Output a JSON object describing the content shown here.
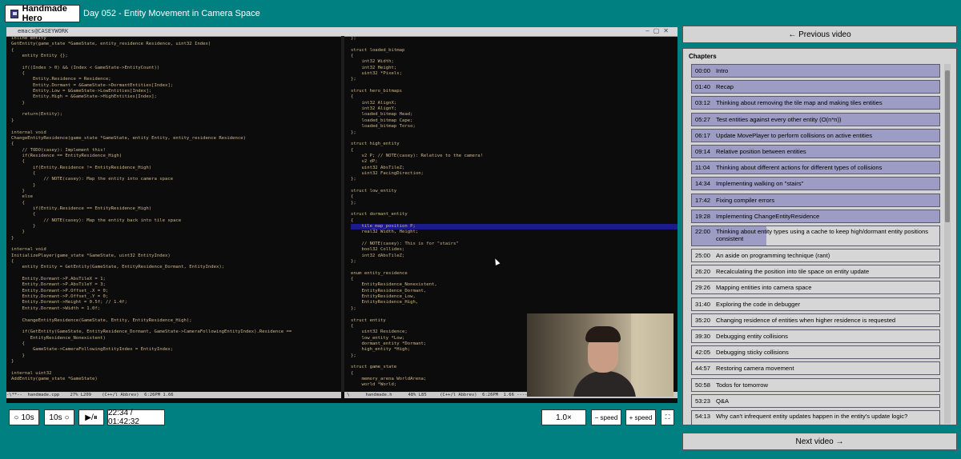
{
  "header": {
    "logo_label": "Handmade Hero",
    "episode_title": "Day 052 - Entity Movement in Camera Space"
  },
  "emacs": {
    "title": "emacs@CASEYWORK",
    "left_modeline": "-\\**--  handmade.cpp    27% L209    (C++/l Abbrev)  6:26PM 1.66",
    "right_modeline": " \\      handmade.h      48% L85     (C++/l Abbrev)  6:26PM  1.66 --------------------"
  },
  "code_left": [
    "inline entity",
    "GetEntity(game_state *GameState, entity_residence Residence, uint32 Index)",
    "{",
    "    entity Entity {};",
    "",
    "    if((Index > 0) && (Index < GameState->EntityCount))",
    "    {",
    "        Entity.Residence = Residence;",
    "        Entity.Dormant = &GameState->DormantEntities[Index];",
    "        Entity.Low = &GameState->LowEntities[Index];",
    "        Entity.High = &GameState->HighEntities[Index];",
    "    }",
    "",
    "    return(Entity);",
    "}",
    "",
    "internal void",
    "ChangeEntityResidence(game_state *GameState, entity Entity, entity_residence Residence)",
    "{",
    "    // TODO(casey): Implement this!",
    "    if(Residence == EntityResidence_High)",
    "    {",
    "        if(Entity.Residence != EntityResidence_High)",
    "        {",
    "            // NOTE(casey): Map the entity into camera space",
    "        }",
    "    }",
    "    else",
    "    {",
    "        if(Entity.Residence == EntityResidence_High)",
    "        {",
    "            // NOTE(casey): Map the entity back into tile space",
    "        }",
    "    }",
    "}",
    "",
    "internal void",
    "InitializePlayer(game_state *GameState, uint32 EntityIndex)",
    "{",
    "    entity Entity = GetEntity(GameState, EntityResidence_Dormant, EntityIndex);",
    "",
    "    Entity.Dormant->P.AbsTileX = 1;",
    "    Entity.Dormant->P.AbsTileY = 3;",
    "    Entity.Dormant->P.Offset_.X = 0;",
    "    Entity.Dormant->P.Offset_.Y = 0;",
    "    Entity.Dormant->Height = 0.5f; // 1.4f;",
    "    Entity.Dormant->Width = 1.0f;",
    "",
    "    ChangeEntityResidence(GameState, Entity, EntityResidence_High);",
    "",
    "    if(GetEntity(GameState, EntityResidence_Dormant, GameState->CameraFollowingEntityIndex).Residence ==",
    "       EntityResidence_Nonexistent)",
    "    {",
    "        GameState->CameraFollowingEntityIndex = EntityIndex;",
    "    }",
    "}",
    "",
    "internal uint32",
    "AddEntity(game_state *GameState)"
  ],
  "code_right": [
    "};",
    "",
    "struct loaded_bitmap",
    "{",
    "    int32 Width;",
    "    int32 Height;",
    "    uint32 *Pixels;",
    "};",
    "",
    "struct hero_bitmaps",
    "{",
    "    int32 AlignX;",
    "    int32 AlignY;",
    "    loaded_bitmap Head;",
    "    loaded_bitmap Cape;",
    "    loaded_bitmap Torso;",
    "};",
    "",
    "struct high_entity",
    "{",
    "    v2 P; // NOTE(casey): Relative to the camera!",
    "    v2 dP;",
    "    uint32 AbsTileZ;",
    "    uint32 FacingDirection;",
    "};",
    "",
    "struct low_entity",
    "{",
    "};",
    "",
    "struct dormant_entity",
    "{",
    "    tile_map_position P;",
    "    real32 Width, Height;",
    "",
    "    // NOTE(casey): This is for \"stairs\"",
    "    bool32 Collides;",
    "    int32 dAbsTileZ;",
    "};",
    "",
    "enum entity_residence",
    "{",
    "    EntityResidence_Nonexistent,",
    "    EntityResidence_Dormant,",
    "    EntityResidence_Low,",
    "    EntityResidence_High,",
    "};",
    "",
    "struct entity",
    "{",
    "    uint32 Residence;",
    "    low_entity *Low;",
    "    dormant_entity *Dormant;",
    "    high_entity *High;",
    "};",
    "",
    "struct game_state",
    "{",
    "    memory_arena WorldArena;",
    "    world *World;"
  ],
  "code_right_highlight_line": 32,
  "player": {
    "back_label": "10s",
    "forward_label": "10s",
    "play_pause_label": "▶/⏸",
    "time_display": "22:34 / 01:42:32",
    "speed_display": "1.0×",
    "speed_down_label": "− speed",
    "speed_up_label": "+ speed",
    "fullscreen_icon": "fullscreen-icon"
  },
  "navigation": {
    "previous_label": "← Previous video",
    "next_label": "Next video →"
  },
  "chapters": {
    "heading": "Chapters",
    "current_progress": 0.3,
    "items": [
      {
        "time": "00:00",
        "title": "Intro",
        "watched": true
      },
      {
        "time": "01:40",
        "title": "Recap",
        "watched": true
      },
      {
        "time": "03:12",
        "title": "Thinking about removing the tile map and making tiles entities",
        "watched": true
      },
      {
        "time": "05:27",
        "title": "Test entities against every other entity (O(n*n))",
        "watched": true
      },
      {
        "time": "06:17",
        "title": "Update MovePlayer to perform collisions on active entities",
        "watched": true
      },
      {
        "time": "09:14",
        "title": "Relative position between entities",
        "watched": true
      },
      {
        "time": "11:04",
        "title": "Thinking about different actions for different types of collisions",
        "watched": true
      },
      {
        "time": "14:34",
        "title": "Implementing walking on \"stairs\"",
        "watched": true
      },
      {
        "time": "17:42",
        "title": "Fixing compiler errors",
        "watched": true
      },
      {
        "time": "19:28",
        "title": "Implementing ChangeEntityResidence",
        "watched": true
      },
      {
        "time": "22:00",
        "title": "Thinking about entity types using a cache to keep high/dormant entity positions consistent",
        "watched": false,
        "current": true
      },
      {
        "time": "25:00",
        "title": "An aside on programming technique (rant)",
        "watched": false
      },
      {
        "time": "26:20",
        "title": "Recalculating the position into tile space on entity update",
        "watched": false
      },
      {
        "time": "29:26",
        "title": "Mapping entities into camera space",
        "watched": false
      },
      {
        "time": "31:40",
        "title": "Exploring the code in debugger",
        "watched": false
      },
      {
        "time": "35:20",
        "title": "Changing residence of entities when higher residence is requested",
        "watched": false
      },
      {
        "time": "39:30",
        "title": "Debugging entity collisions",
        "watched": false
      },
      {
        "time": "42:05",
        "title": "Debugging sticky collisions",
        "watched": false
      },
      {
        "time": "44:57",
        "title": "Restoring camera movement",
        "watched": false
      },
      {
        "time": "50:58",
        "title": "Todos for tomorrow",
        "watched": false
      },
      {
        "time": "53:23",
        "title": "Q&A",
        "watched": false
      },
      {
        "time": "54:13",
        "title": "Why can't infrequent entity updates happen in the entity's update logic?",
        "watched": false
      }
    ]
  }
}
